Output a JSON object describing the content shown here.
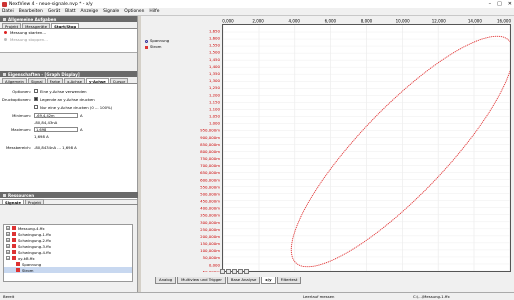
{
  "window": {
    "title": "NextView 4 - neue-signale.nvp * - x/y"
  },
  "menu": [
    "Datei",
    "Bearbeiten",
    "Gerät",
    "Blatt",
    "Anzeige",
    "Signale",
    "Optionen",
    "Hilfe"
  ],
  "tasks_panel": {
    "title": "Allgemeine Aufgaben",
    "tabs": [
      "Projekt",
      "Messgeräte",
      "Start/Stop"
    ],
    "items": [
      "Messung starten...",
      "Messung stoppen..."
    ]
  },
  "props_panel": {
    "title": "Eigenschaften - [Graph Display]",
    "tabs": [
      "Allgemein",
      "Signal",
      "Farbe",
      "x-Achse",
      "y-Achse",
      "Cursor"
    ],
    "options_label": "Optionen:",
    "option_1": "Eine y-Achse verwenden",
    "print_label": "Druckoptionen:",
    "print_1": "Legende an y-Achse drucken",
    "print_2": "Nur eine y-Achse drucken (0 ... 100%)",
    "min_label": "Minimum:",
    "min_value": "-69,4,42m",
    "min_unit": "A",
    "min_sub": "-80,84,43nA",
    "max_label": "Maximum:",
    "max_value": "1,698",
    "max_unit": "A",
    "max_sub": "1,698 A",
    "range_label": "Messbereich:",
    "range_value": "-80,8434nA ... 1,698 A"
  },
  "resources_panel": {
    "title": "Ressourcen",
    "tabs": [
      "Signale",
      "Projekt"
    ],
    "tree": [
      "Messung-4.ffx",
      "Schwingung-1.ffx",
      "Schwingung-2.ffx",
      "Schwingung-3.ffx",
      "Schwingung-4.ffx",
      "xy-kB.ffx",
      "Spannung",
      "Strom"
    ]
  },
  "chart_data": {
    "type": "line",
    "legend": [
      "Spannung",
      "Strom"
    ],
    "xlim": [
      0,
      16
    ],
    "x_ticks": [
      "0,000",
      "2,000",
      "4,000",
      "6,000",
      "8,000",
      "10,000",
      "12,000",
      "14,000",
      "16,000"
    ],
    "ylim": [
      -0.05,
      1.7
    ],
    "y_ticks": [
      "1,650",
      "1,600",
      "1,550",
      "1,500",
      "1,450",
      "1,400",
      "1,350",
      "1,300",
      "1,250",
      "1,200",
      "1,150",
      "1,100",
      "1,050",
      "1,000",
      "950,000m",
      "900,000m",
      "850,000m",
      "800,000m",
      "750,000m",
      "700,000m",
      "650,000m",
      "600,000m",
      "550,000m",
      "500,000m",
      "450,000m",
      "400,000m",
      "350,000m",
      "300,000m",
      "250,000m",
      "200,000m",
      "150,000m",
      "100,000m",
      "50,000m",
      "0,000",
      "-50,000m"
    ],
    "series": [
      {
        "name": "Strom",
        "shape": "ellipse",
        "center_x": 10,
        "center_y": 0.8,
        "color": "#e03030"
      }
    ]
  },
  "bottom_tabs": [
    "Analog",
    "Multiview und Trigger",
    "Base Analyse",
    "x/y",
    "Filtertest"
  ],
  "status": {
    "left": "Bereit",
    "center": "Leerlauf messen",
    "right": "C:\\...\\Messung-1.ffx"
  },
  "colors": {
    "curve": "#e03030",
    "axis_text": "#cc0000",
    "header": "#6a6a6a"
  }
}
